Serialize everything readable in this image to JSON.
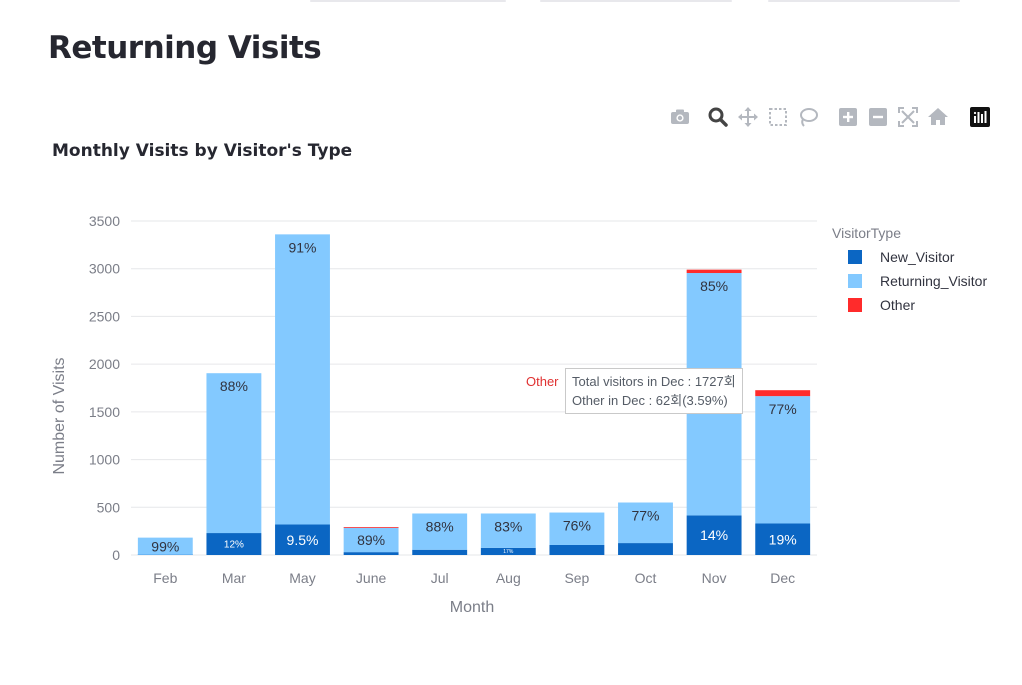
{
  "page": {
    "title": "Returning Visits"
  },
  "modebar": {
    "buttons": [
      {
        "name": "camera-icon",
        "title": "Download plot as a png"
      },
      {
        "name": "zoom-icon",
        "title": "Zoom"
      },
      {
        "name": "pan-icon",
        "title": "Pan"
      },
      {
        "name": "box-select-icon",
        "title": "Box Select"
      },
      {
        "name": "lasso-select-icon",
        "title": "Lasso Select"
      },
      {
        "name": "zoom-in-icon",
        "title": "Zoom in"
      },
      {
        "name": "zoom-out-icon",
        "title": "Zoom out"
      },
      {
        "name": "autoscale-icon",
        "title": "Autoscale"
      },
      {
        "name": "home-icon",
        "title": "Reset axes"
      },
      {
        "name": "plotly-logo-icon",
        "title": "Produced with Plotly"
      }
    ]
  },
  "tooltip": {
    "trace": "Other",
    "line1": "Total visitors in Dec : 1727회",
    "line2": "Other in Dec : 62회(3.59%)"
  },
  "chart_data": {
    "type": "bar",
    "barmode": "stack",
    "title": "Monthly Visits by Visitor's Type",
    "xlabel": "Month",
    "ylabel": "Number of Visits",
    "ylim": [
      0,
      3500
    ],
    "yticks": [
      0,
      500,
      1000,
      1500,
      2000,
      2500,
      3000,
      3500
    ],
    "grid": true,
    "legend_title": "VisitorType",
    "legend_position": "right",
    "categories": [
      "Feb",
      "Mar",
      "May",
      "June",
      "Jul",
      "Aug",
      "Sep",
      "Oct",
      "Nov",
      "Dec"
    ],
    "series": [
      {
        "name": "New_Visitor",
        "color": "#0b66c3",
        "values": [
          2,
          230,
          320,
          30,
          55,
          75,
          105,
          125,
          415,
          330
        ],
        "labels": [
          "",
          "12%",
          "9.5%",
          "",
          "",
          "17%",
          "",
          "",
          "14%",
          "19%"
        ]
      },
      {
        "name": "Returning_Visitor",
        "color": "#83c9ff",
        "values": [
          180,
          1675,
          3040,
          255,
          380,
          360,
          340,
          425,
          2540,
          1335
        ],
        "labels": [
          "99%",
          "88%",
          "91%",
          "89%",
          "88%",
          "83%",
          "76%",
          "77%",
          "85%",
          "77%"
        ]
      },
      {
        "name": "Other",
        "color": "#ff2b2b",
        "values": [
          0,
          0,
          0,
          5,
          0,
          0,
          0,
          0,
          35,
          62
        ],
        "labels": [
          "",
          "",
          "",
          "",
          "",
          "",
          "",
          "",
          "",
          ""
        ]
      }
    ]
  }
}
